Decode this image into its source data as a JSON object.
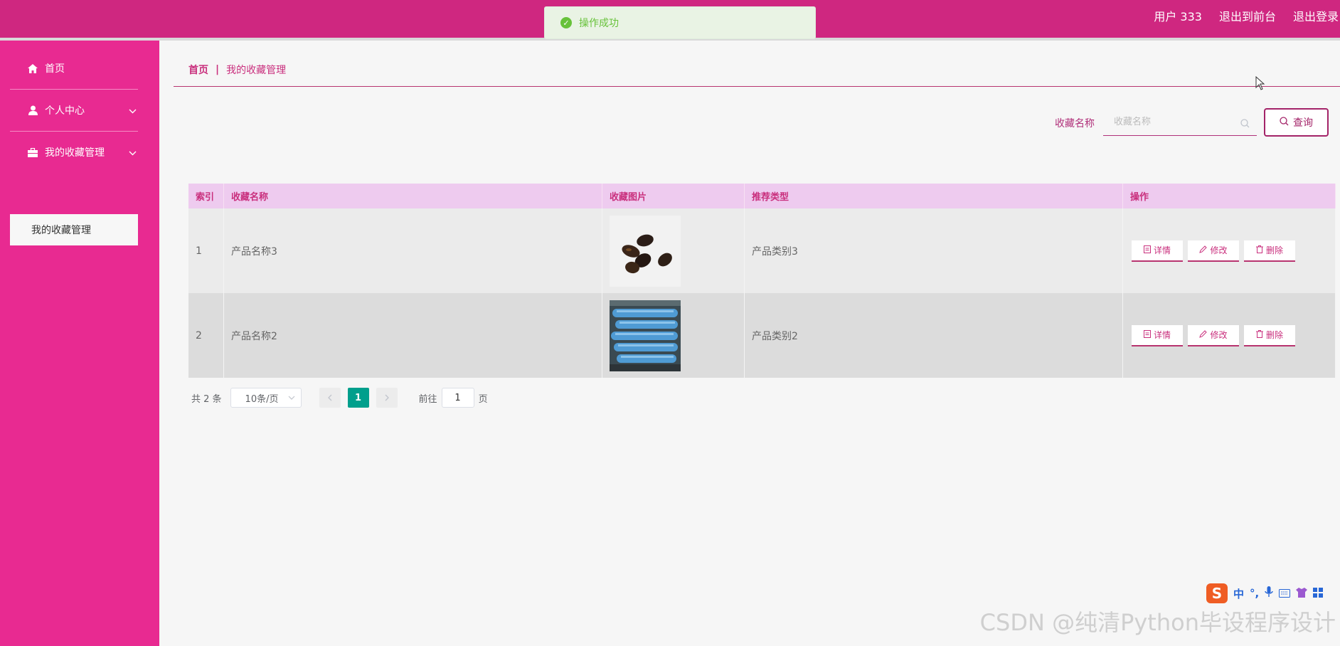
{
  "header": {
    "user_label": "用户 333",
    "back_to_front": "退出到前台",
    "logout": "退出登录",
    "bg_color": "#cf2780"
  },
  "toast": {
    "message": "操作成功",
    "icon": "check-circle-icon"
  },
  "sidebar": {
    "items": [
      {
        "label": "首页",
        "icon": "home-icon"
      },
      {
        "label": "个人中心",
        "icon": "user-icon"
      },
      {
        "label": "我的收藏管理",
        "icon": "briefcase-icon"
      }
    ],
    "sub_item": "我的收藏管理",
    "bg_color": "#e82a91"
  },
  "breadcrumb": {
    "home": "首页",
    "separator": "|",
    "current": "我的收藏管理"
  },
  "search": {
    "label": "收藏名称",
    "placeholder": "收藏名称",
    "value": "",
    "button_label": "查询"
  },
  "table": {
    "headers": [
      "索引",
      "收藏名称",
      "收藏图片",
      "推荐类型",
      "操作"
    ],
    "rows": [
      {
        "index": "1",
        "name": "产品名称3",
        "image": "seeds-photo",
        "type": "产品类别3"
      },
      {
        "index": "2",
        "name": "产品名称2",
        "image": "blue-rolls-photo",
        "type": "产品类别2"
      }
    ],
    "actions": {
      "detail": "详情",
      "edit": "修改",
      "delete": "删除"
    }
  },
  "pagination": {
    "total": "共 2 条",
    "page_size": "10条/页",
    "current_page": "1",
    "goto_prefix": "前往",
    "goto_value": "1",
    "goto_suffix": "页"
  },
  "watermark": "CSDN @纯清Python毕设程序设计",
  "ime": {
    "logo": "S",
    "mode": "中",
    "punct": "°,"
  }
}
